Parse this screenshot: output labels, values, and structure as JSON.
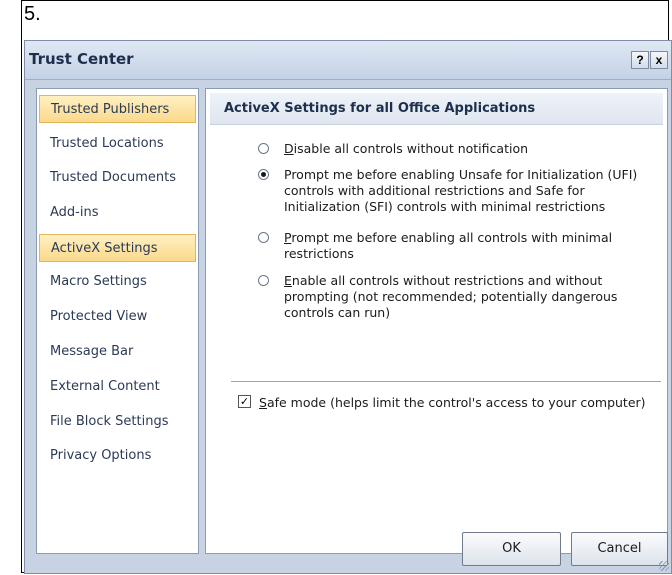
{
  "step_label": "5.",
  "dialog": {
    "title": "Trust Center",
    "help_glyph": "?",
    "close_glyph": "x"
  },
  "sidebar": {
    "items": [
      {
        "label": "Trusted Publishers"
      },
      {
        "label": "Trusted Locations"
      },
      {
        "label": "Trusted Documents"
      },
      {
        "label": "Add-ins"
      },
      {
        "label": "ActiveX Settings"
      },
      {
        "label": "Macro Settings"
      },
      {
        "label": "Protected View"
      },
      {
        "label": "Message Bar"
      },
      {
        "label": "External Content"
      },
      {
        "label": "File Block Settings"
      },
      {
        "label": "Privacy Options"
      }
    ],
    "selected_index": 4
  },
  "content": {
    "header": "ActiveX Settings for all Office Applications",
    "options": [
      {
        "accel": "D",
        "text": "isable all controls without notification",
        "selected": false
      },
      {
        "accel": "",
        "text": "Prompt me before enabling Unsafe for Initialization (UFI) controls with additional restrictions and Safe for Initialization (SFI) controls with minimal restrictions",
        "selected": true
      },
      {
        "accel": "P",
        "text": "rompt me before enabling all controls with minimal restrictions",
        "selected": false
      },
      {
        "accel": "E",
        "text": "nable all controls without restrictions and without prompting (not recommended; potentially dangerous controls can run)",
        "selected": false
      }
    ],
    "safe_mode": {
      "accel": "S",
      "text": "afe mode (helps limit the control's access to your computer)",
      "checked": true
    }
  },
  "buttons": {
    "ok": "OK",
    "cancel": "Cancel"
  },
  "colors": {
    "selected_nav": "#fbd98a",
    "dialog_bg": "#c7d3e3"
  }
}
